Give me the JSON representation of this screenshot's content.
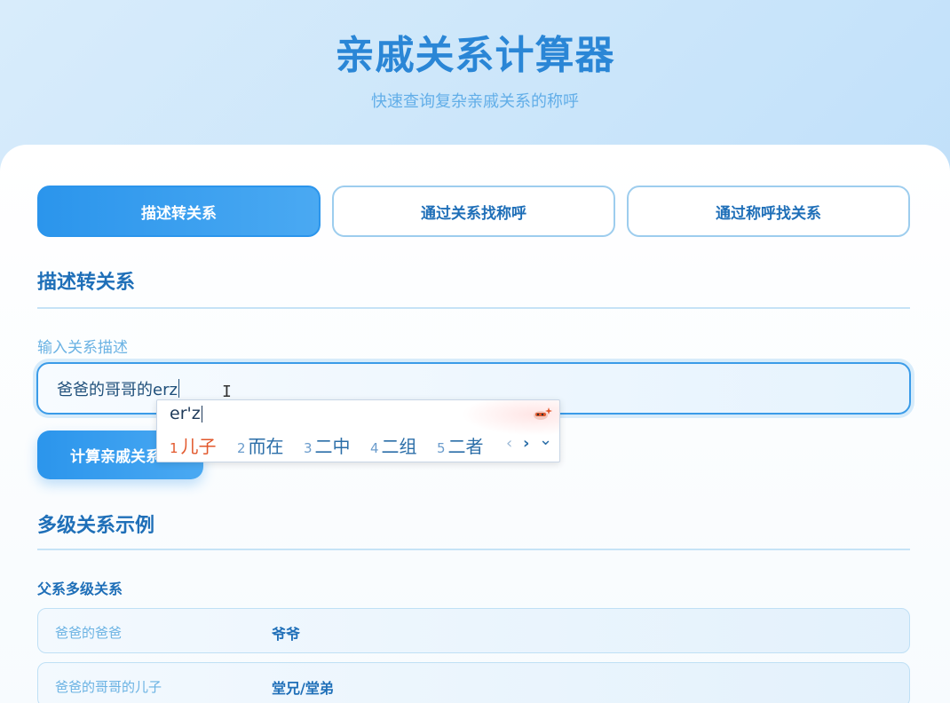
{
  "header": {
    "title": "亲戚关系计算器",
    "subtitle": "快速查询复杂亲戚关系的称呼"
  },
  "tabs": [
    {
      "label": "描述转关系",
      "active": true
    },
    {
      "label": "通过关系找称呼",
      "active": false
    },
    {
      "label": "通过称呼找关系",
      "active": false
    }
  ],
  "describe_section": {
    "title": "描述转关系",
    "input_label": "输入关系描述",
    "input_value": "爸爸的哥哥的erz",
    "calc_button_label": "计算亲戚关系"
  },
  "ime": {
    "pinyin": "er'z",
    "candidates": [
      {
        "num": "1",
        "text": "儿子"
      },
      {
        "num": "2",
        "text": "而在"
      },
      {
        "num": "3",
        "text": "二中"
      },
      {
        "num": "4",
        "text": "二组"
      },
      {
        "num": "5",
        "text": "二者"
      }
    ],
    "prev_label": "‹",
    "next_label": "›",
    "expand_label": "⌄"
  },
  "examples_section": {
    "title": "多级关系示例",
    "group_title": "父系多级关系",
    "rows": [
      {
        "desc": "爸爸的爸爸",
        "result": "爷爷"
      },
      {
        "desc": "爸爸的哥哥的儿子",
        "result": "堂兄/堂弟"
      }
    ]
  },
  "colors": {
    "accent": "#2b95ec",
    "title": "#2a86d6",
    "ime_highlight": "#e2572b"
  }
}
